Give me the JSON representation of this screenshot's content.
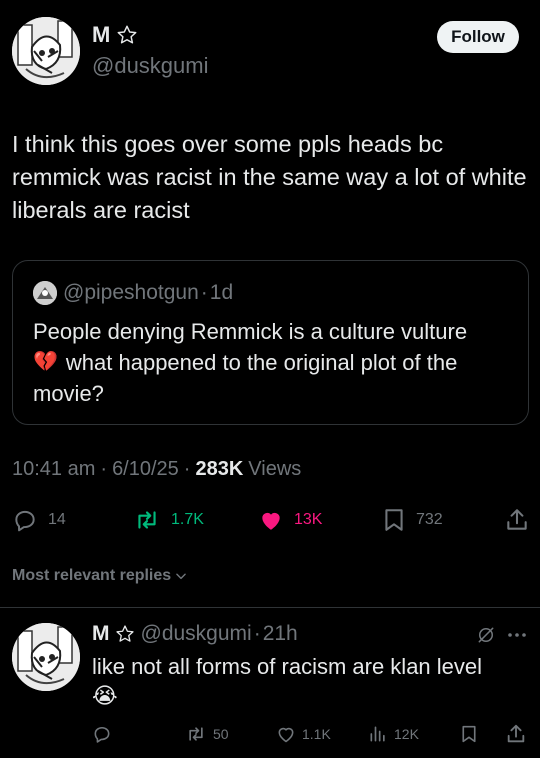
{
  "main_tweet": {
    "author_name": "M",
    "author_handle": "@duskgumi",
    "follow_label": "Follow",
    "text": "I think this goes over some ppls heads bc remmick was racist in the same way a lot of white liberals are racist",
    "quote": {
      "handle": "@pipeshotgun",
      "sep": "·",
      "age": "1d",
      "text_line1": "People denying Remmick is a culture vulture",
      "emoji": "💔",
      "text_line2": "what happened to the original plot of the",
      "text_line3": "movie?"
    },
    "time": "10:41 am",
    "dot1": "·",
    "date": "6/10/25",
    "dot2": "·",
    "views_count": "283K",
    "views_label": "Views",
    "stats": {
      "replies": "14",
      "reposts": "1.7K",
      "likes": "13K",
      "bookmarks": "732"
    }
  },
  "sort_label": "Most relevant replies",
  "reply": {
    "author_name": "M",
    "author_handle": "@duskgumi",
    "sep": "·",
    "age": "21h",
    "text": "like not all forms of racism are klan level",
    "emoji": "😭",
    "stats": {
      "reposts": "50",
      "likes": "1.1K",
      "views": "12K"
    }
  },
  "colors": {
    "background": "#000000",
    "text": "#e7e9ea",
    "muted": "#71767b",
    "repost_green": "#00ba7c",
    "like_pink": "#f91880",
    "border": "#2f3336"
  }
}
